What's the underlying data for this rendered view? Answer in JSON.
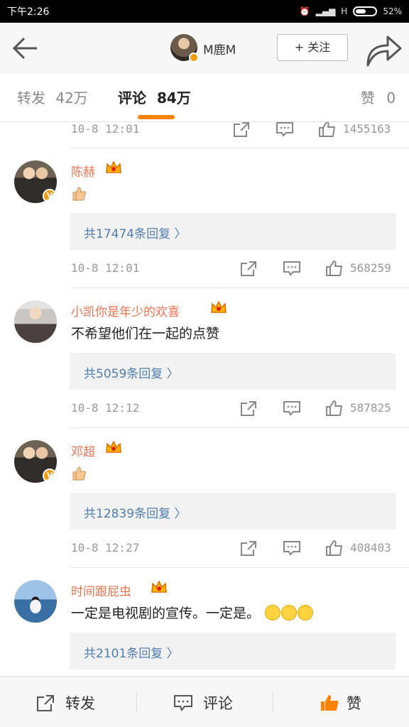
{
  "status_bar": {
    "time": "下午2:26",
    "network": "H",
    "battery": "52%"
  },
  "nav": {
    "user_name": "M鹿M",
    "follow_label": "+ 关注"
  },
  "tabs": [
    {
      "label": "转发",
      "count": "42万"
    },
    {
      "label": "评论",
      "count": "84万"
    },
    {
      "label": "赞",
      "count": "0"
    }
  ],
  "feed": {
    "top_partial": {
      "time": "10-8 12:01",
      "likes": "1455163"
    },
    "comments": [
      {
        "user": "陈赫",
        "text": "",
        "emoji": "thumbs-up",
        "replies": "共17474条回复 〉",
        "time": "10-8 12:01",
        "likes": "568259"
      },
      {
        "user": "小凯你是年少的欢喜",
        "text": "不希望他们在一起的点赞",
        "emoji": "",
        "replies": "共5059条回复 〉",
        "time": "10-8 12:12",
        "likes": "587825"
      },
      {
        "user": "邓超",
        "text": "",
        "emoji": "thumbs-up",
        "replies": "共12839条回复 〉",
        "time": "10-8 12:27",
        "likes": "408403"
      },
      {
        "user": "时间跟屁虫",
        "text": "一定是电视剧的宣传。一定是。",
        "emoji": "laughing-crying x3",
        "replies": "共2101条回复 〉",
        "time": "",
        "likes": ""
      }
    ]
  },
  "bottom_bar": {
    "repost": "转发",
    "comment": "评论",
    "like": "赞"
  },
  "colors": {
    "accent": "#ff8200",
    "username": "#eb7350",
    "link": "#507daf"
  }
}
